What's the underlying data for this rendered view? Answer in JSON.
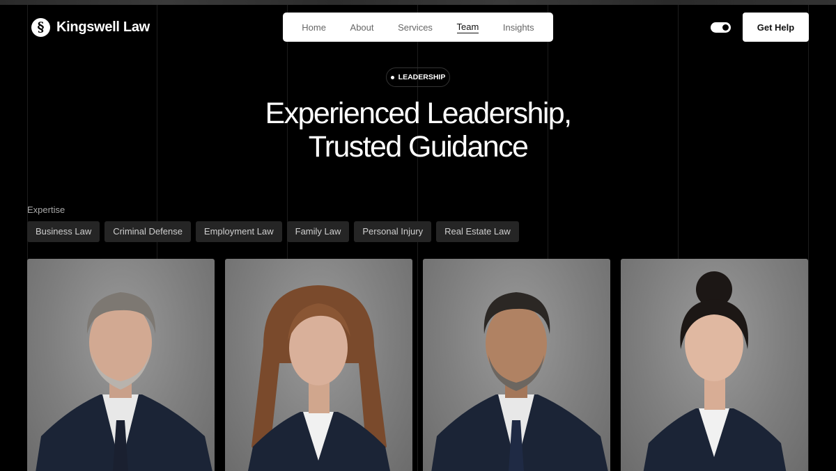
{
  "brand": {
    "logo_icon": "section-sign-icon",
    "logo_glyph": "§",
    "name": "Kingswell Law"
  },
  "nav": {
    "items": [
      {
        "label": "Home",
        "active": false
      },
      {
        "label": "About",
        "active": false
      },
      {
        "label": "Services",
        "active": false
      },
      {
        "label": "Team",
        "active": true
      },
      {
        "label": "Insights",
        "active": false
      }
    ]
  },
  "header": {
    "theme_toggle": "toggle-icon",
    "cta_label": "Get Help"
  },
  "hero": {
    "badge": "LEADERSHIP",
    "title_line1": "Experienced Leadership,",
    "title_line2": "Trusted Guidance"
  },
  "expertise": {
    "label": "Expertise",
    "chips": [
      "Business Law",
      "Criminal Defense",
      "Employment Law",
      "Family Law",
      "Personal Injury",
      "Real Estate Law"
    ]
  },
  "team": {
    "cards": [
      {
        "photo": "portrait-man-gray-hair"
      },
      {
        "photo": "portrait-woman-auburn-hair"
      },
      {
        "photo": "portrait-man-dark-hair"
      },
      {
        "photo": "portrait-woman-dark-updo"
      }
    ]
  },
  "colors": {
    "background": "#000000",
    "surface": "#ffffff",
    "chip": "#252525",
    "suit": "#1b2436"
  }
}
